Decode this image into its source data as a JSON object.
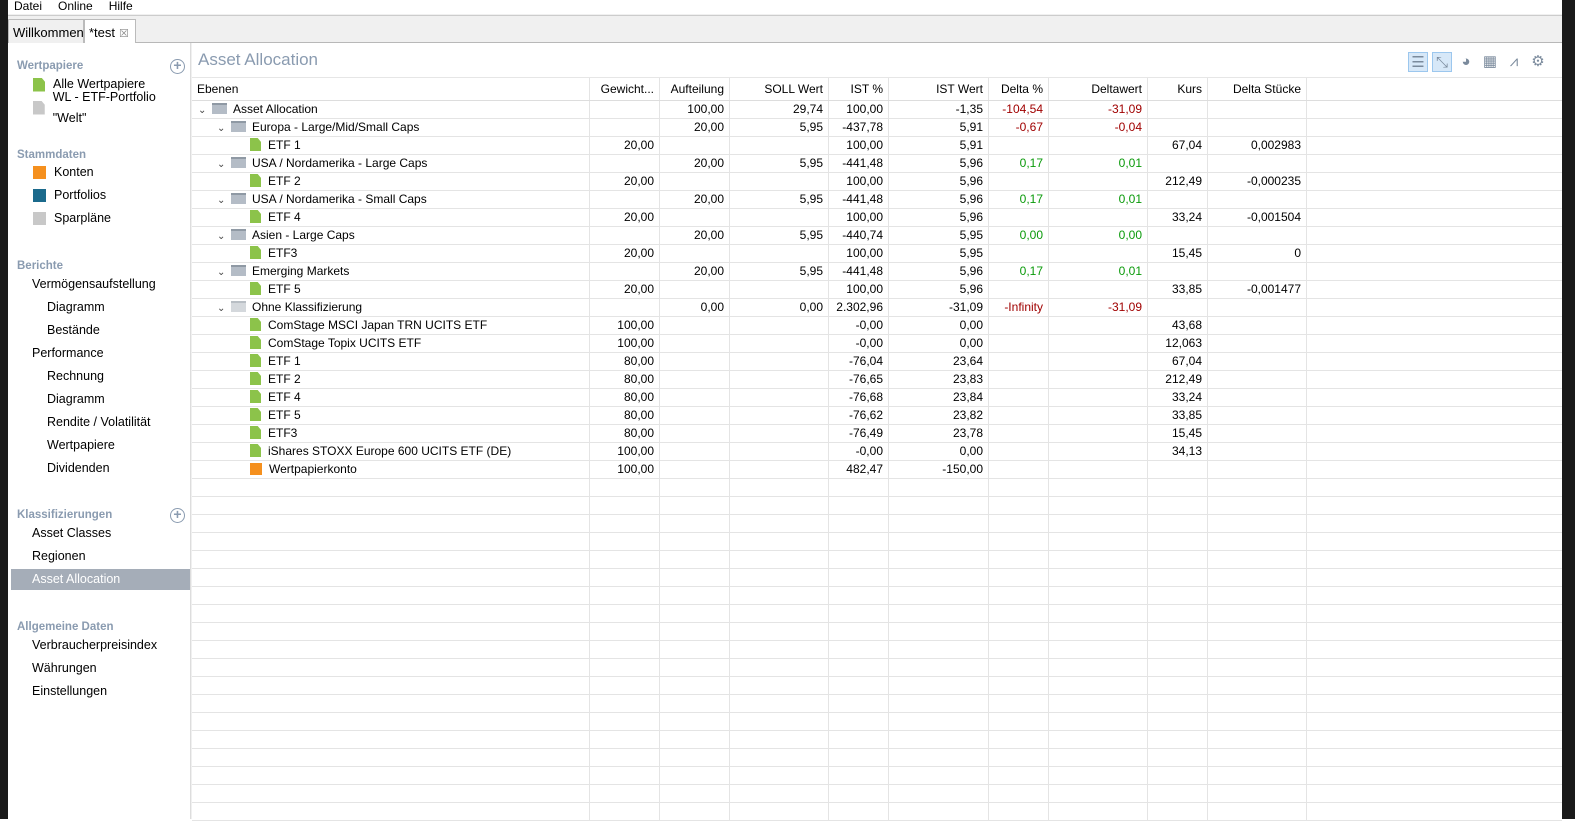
{
  "menu": [
    "Datei",
    "Online",
    "Hilfe"
  ],
  "tabs": {
    "welcome": "Willkommen",
    "test": "*test"
  },
  "sidebar": {
    "wertpapiere": {
      "title": "Wertpapiere",
      "items": [
        "Alle Wertpapiere",
        "WL - ETF-Portfolio \"Welt\""
      ]
    },
    "stammdaten": {
      "title": "Stammdaten",
      "items": [
        "Konten",
        "Portfolios",
        "Sparpläne"
      ]
    },
    "berichte": {
      "title": "Berichte",
      "items": [
        "Vermögensaufstellung",
        "Diagramm",
        "Bestände",
        "Performance",
        "Rechnung",
        "Diagramm",
        "Rendite / Volatilität",
        "Wertpapiere",
        "Dividenden"
      ]
    },
    "klass": {
      "title": "Klassifizierungen",
      "items": [
        "Asset Classes",
        "Regionen",
        "Asset Allocation"
      ]
    },
    "allg": {
      "title": "Allgemeine Daten",
      "items": [
        "Verbraucherpreisindex",
        "Währungen",
        "Einstellungen"
      ]
    }
  },
  "main": {
    "title": "Asset Allocation"
  },
  "table": {
    "headers": [
      "Ebenen",
      "Gewicht...",
      "Aufteilung",
      "SOLL Wert",
      "IST %",
      "IST Wert",
      "Delta %",
      "Deltawert",
      "Kurs",
      "Delta Stücke"
    ],
    "rows": [
      [
        0,
        "folder",
        "Asset Allocation",
        "",
        "100,00",
        "29,74",
        "100,00",
        "-1,35",
        "-104,54",
        "-31,09",
        "",
        "",
        "neg"
      ],
      [
        1,
        "folder",
        "Europa -  Large/Mid/Small Caps",
        "",
        "20,00",
        "5,95",
        "-437,78",
        "5,91",
        "-0,67",
        "-0,04",
        "",
        "",
        "neg"
      ],
      [
        2,
        "sec",
        "ETF 1",
        "20,00",
        "",
        "",
        "100,00",
        "5,91",
        "",
        "",
        "67,04",
        "0,002983",
        ""
      ],
      [
        1,
        "folder",
        "USA / Nordamerika - Large Caps",
        "",
        "20,00",
        "5,95",
        "-441,48",
        "5,96",
        "0,17",
        "0,01",
        "",
        "",
        "pos"
      ],
      [
        2,
        "sec",
        "ETF 2",
        "20,00",
        "",
        "",
        "100,00",
        "5,96",
        "",
        "",
        "212,49",
        "-0,000235",
        ""
      ],
      [
        1,
        "folder",
        "USA / Nordamerika - Small Caps",
        "",
        "20,00",
        "5,95",
        "-441,48",
        "5,96",
        "0,17",
        "0,01",
        "",
        "",
        "pos"
      ],
      [
        2,
        "sec",
        "ETF 4",
        "20,00",
        "",
        "",
        "100,00",
        "5,96",
        "",
        "",
        "33,24",
        "-0,001504",
        ""
      ],
      [
        1,
        "folder",
        "Asien - Large Caps",
        "",
        "20,00",
        "5,95",
        "-440,74",
        "5,95",
        "0,00",
        "0,00",
        "",
        "",
        "pos"
      ],
      [
        2,
        "sec",
        "ETF3",
        "20,00",
        "",
        "",
        "100,00",
        "5,95",
        "",
        "",
        "15,45",
        "0",
        ""
      ],
      [
        1,
        "folder",
        "Emerging Markets",
        "",
        "20,00",
        "5,95",
        "-441,48",
        "5,96",
        "0,17",
        "0,01",
        "",
        "",
        "pos"
      ],
      [
        2,
        "sec",
        "ETF 5",
        "20,00",
        "",
        "",
        "100,00",
        "5,96",
        "",
        "",
        "33,85",
        "-0,001477",
        ""
      ],
      [
        1,
        "folder2",
        "Ohne Klassifizierung",
        "",
        "0,00",
        "0,00",
        "2.302,96",
        "-31,09",
        "-Infinity",
        "-31,09",
        "",
        "",
        "neg"
      ],
      [
        2,
        "sec",
        "ComStage MSCI Japan TRN UCITS ETF",
        "100,00",
        "",
        "",
        "-0,00",
        "0,00",
        "",
        "",
        "43,68",
        "",
        ""
      ],
      [
        2,
        "sec",
        "ComStage Topix UCITS ETF",
        "100,00",
        "",
        "",
        "-0,00",
        "0,00",
        "",
        "",
        "12,063",
        "",
        ""
      ],
      [
        2,
        "sec",
        "ETF 1",
        "80,00",
        "",
        "",
        "-76,04",
        "23,64",
        "",
        "",
        "67,04",
        "",
        ""
      ],
      [
        2,
        "sec",
        "ETF 2",
        "80,00",
        "",
        "",
        "-76,65",
        "23,83",
        "",
        "",
        "212,49",
        "",
        ""
      ],
      [
        2,
        "sec",
        "ETF 4",
        "80,00",
        "",
        "",
        "-76,68",
        "23,84",
        "",
        "",
        "33,24",
        "",
        ""
      ],
      [
        2,
        "sec",
        "ETF 5",
        "80,00",
        "",
        "",
        "-76,62",
        "23,82",
        "",
        "",
        "33,85",
        "",
        ""
      ],
      [
        2,
        "sec",
        "ETF3",
        "80,00",
        "",
        "",
        "-76,49",
        "23,78",
        "",
        "",
        "15,45",
        "",
        ""
      ],
      [
        2,
        "sec",
        "iShares STOXX Europe 600 UCITS ETF (DE)",
        "100,00",
        "",
        "",
        "-0,00",
        "0,00",
        "",
        "",
        "34,13",
        "",
        ""
      ],
      [
        2,
        "acct",
        "Wertpapierkonto",
        "100,00",
        "",
        "",
        "482,47",
        "-150,00",
        "",
        "",
        "",
        "",
        ""
      ]
    ]
  },
  "colors": {
    "neg": "#a00000",
    "pos": "#0a9a0a",
    "accent": "#8a9bb0"
  }
}
